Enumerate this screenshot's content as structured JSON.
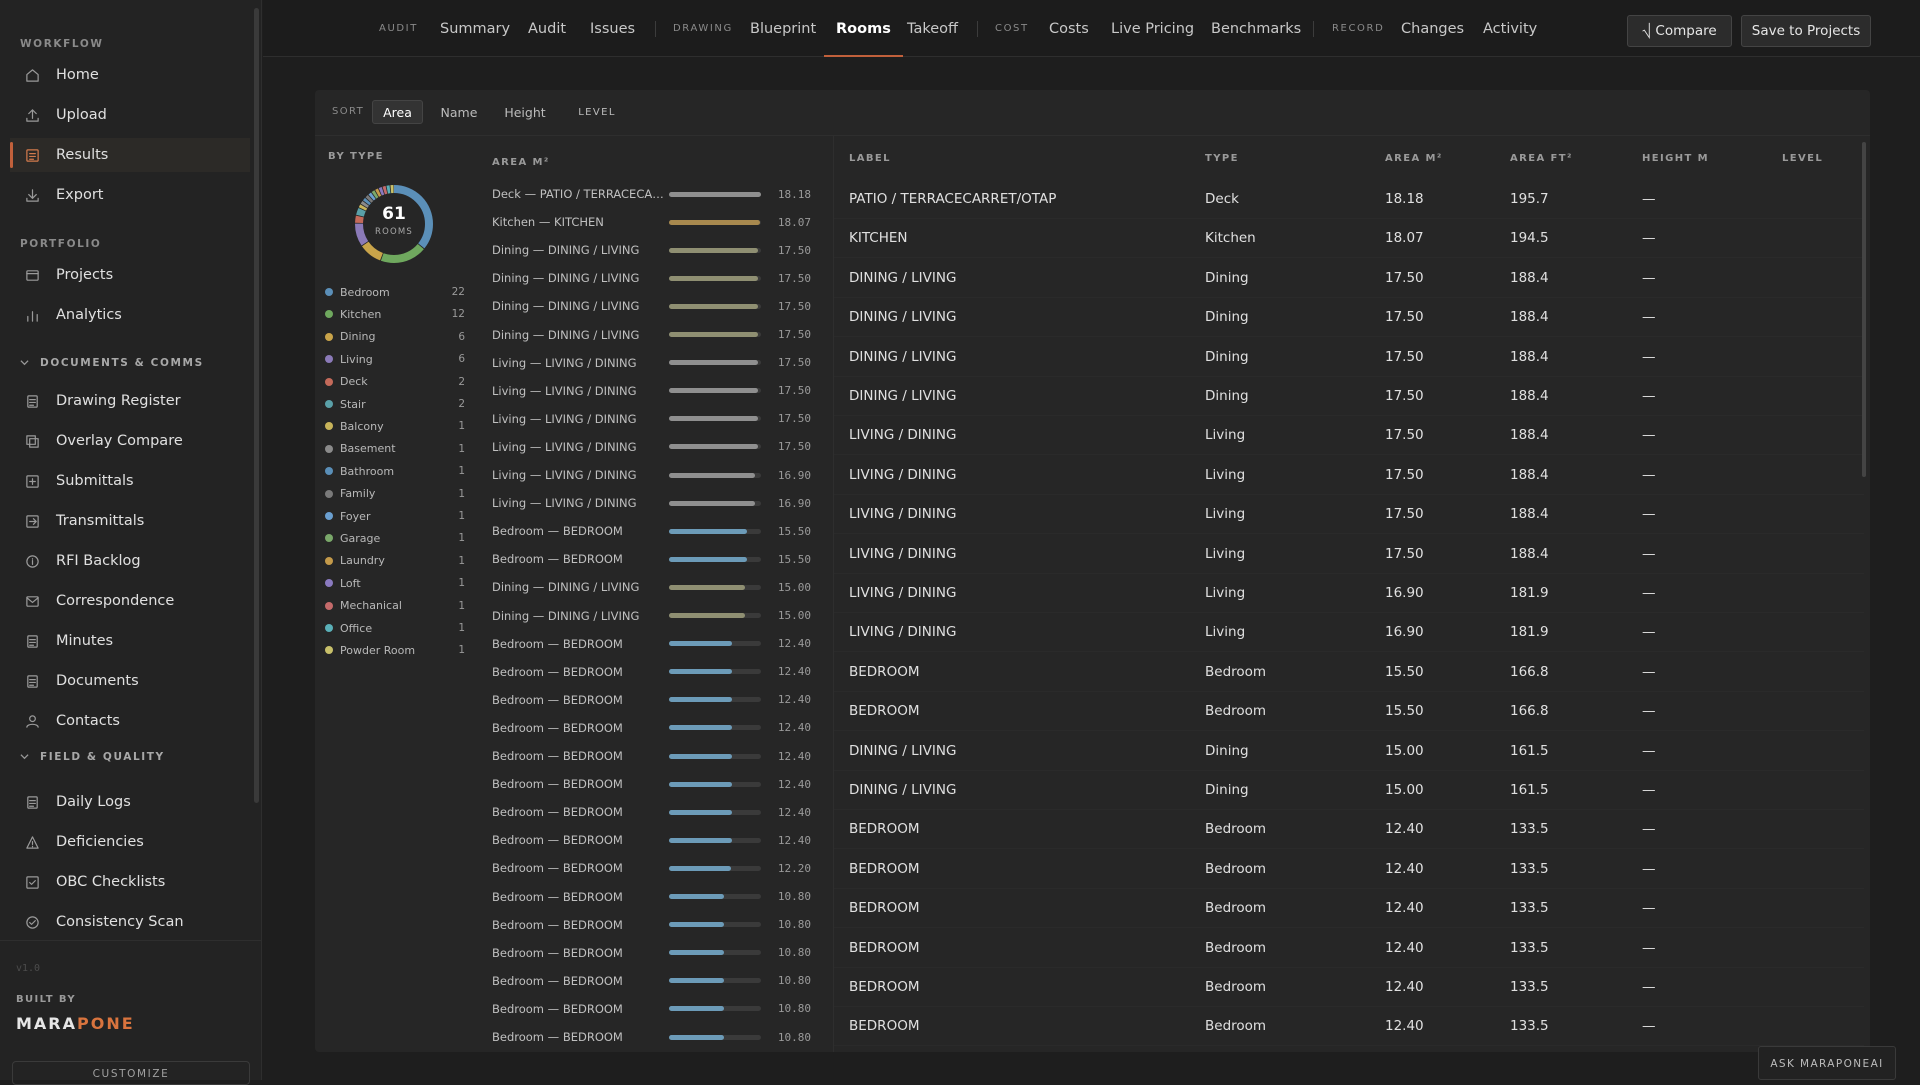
{
  "sidebar": {
    "groups": {
      "workflow": "WORKFLOW",
      "portfolio": "PORTFOLIO",
      "docs": "DOCUMENTS & COMMS",
      "field": "FIELD & QUALITY"
    },
    "items": [
      {
        "label": "Home",
        "icon": "home-icon"
      },
      {
        "label": "Upload",
        "icon": "upload-icon"
      },
      {
        "label": "Results",
        "icon": "results-icon"
      },
      {
        "label": "Export",
        "icon": "export-icon"
      },
      {
        "label": "Projects",
        "icon": "projects-icon"
      },
      {
        "label": "Analytics",
        "icon": "analytics-icon"
      },
      {
        "label": "Drawing Register",
        "icon": "document-icon"
      },
      {
        "label": "Overlay Compare",
        "icon": "overlay-icon"
      },
      {
        "label": "Submittals",
        "icon": "submittals-icon"
      },
      {
        "label": "Transmittals",
        "icon": "transmittals-icon"
      },
      {
        "label": "RFI Backlog",
        "icon": "info-icon"
      },
      {
        "label": "Correspondence",
        "icon": "mail-icon"
      },
      {
        "label": "Minutes",
        "icon": "document-icon"
      },
      {
        "label": "Documents",
        "icon": "document-icon"
      },
      {
        "label": "Contacts",
        "icon": "user-icon"
      },
      {
        "label": "Daily Logs",
        "icon": "document-icon"
      },
      {
        "label": "Deficiencies",
        "icon": "warning-icon"
      },
      {
        "label": "OBC Checklists",
        "icon": "checklist-icon"
      },
      {
        "label": "Consistency Scan",
        "icon": "check-circle-icon"
      }
    ],
    "version": "v1.0",
    "built_by": "BUILT BY",
    "brand_a": "MARA",
    "brand_b": "PONE",
    "customize": "CUSTOMIZE"
  },
  "topbar": {
    "groups": {
      "audit": "AUDIT",
      "drawing": "DRAWING",
      "cost": "COST",
      "record": "RECORD"
    },
    "tabs": {
      "summary": "Summary",
      "audit": "Audit",
      "issues": "Issues",
      "blueprint": "Blueprint",
      "rooms": "Rooms",
      "takeoff": "Takeoff",
      "costs": "Costs",
      "live_pricing": "Live Pricing",
      "benchmarks": "Benchmarks",
      "changes": "Changes",
      "activity": "Activity"
    },
    "active_tab": "Rooms",
    "compare": "⎷ Compare",
    "save": "Save to Projects"
  },
  "sort": {
    "label": "SORT",
    "options": {
      "area": "Area",
      "name": "Name",
      "height": "Height",
      "level": "LEVEL"
    },
    "active": "Area"
  },
  "by_type": {
    "title": "BY TYPE",
    "total": "61",
    "total_label": "ROOMS",
    "types": [
      {
        "name": "Bedroom",
        "count": 22,
        "color": "#5b8fb8"
      },
      {
        "name": "Kitchen",
        "count": 12,
        "color": "#6fa85e"
      },
      {
        "name": "Dining",
        "count": 6,
        "color": "#c9a44a"
      },
      {
        "name": "Living",
        "count": 6,
        "color": "#8b7ab8"
      },
      {
        "name": "Deck",
        "count": 2,
        "color": "#c46a5a"
      },
      {
        "name": "Stair",
        "count": 2,
        "color": "#5aa0a8"
      },
      {
        "name": "Balcony",
        "count": 1,
        "color": "#c8b45a"
      },
      {
        "name": "Basement",
        "count": 1,
        "color": "#8a8a8a"
      },
      {
        "name": "Bathroom",
        "count": 1,
        "color": "#5a8fb8"
      },
      {
        "name": "Family",
        "count": 1,
        "color": "#7a7a7a"
      },
      {
        "name": "Foyer",
        "count": 1,
        "color": "#6a9fd0"
      },
      {
        "name": "Garage",
        "count": 1,
        "color": "#7aa86a"
      },
      {
        "name": "Laundry",
        "count": 1,
        "color": "#c49a4a"
      },
      {
        "name": "Loft",
        "count": 1,
        "color": "#8a7ac0"
      },
      {
        "name": "Mechanical",
        "count": 1,
        "color": "#c46a6a"
      },
      {
        "name": "Office",
        "count": 1,
        "color": "#5ab0b8"
      },
      {
        "name": "Powder Room",
        "count": 1,
        "color": "#c8c06a"
      }
    ]
  },
  "area_list": {
    "title": "AREA M²",
    "rows": [
      {
        "name": "Deck — PATIO / TERRACECAR...",
        "value": "18.18",
        "color": "#8f8f8f"
      },
      {
        "name": "Kitchen — KITCHEN",
        "value": "18.07",
        "color": "#a8894e"
      },
      {
        "name": "Dining — DINING / LIVING",
        "value": "17.50",
        "color": "#8f8f72"
      },
      {
        "name": "Dining — DINING / LIVING",
        "value": "17.50",
        "color": "#8f8f72"
      },
      {
        "name": "Dining — DINING / LIVING",
        "value": "17.50",
        "color": "#8f8f72"
      },
      {
        "name": "Dining — DINING / LIVING",
        "value": "17.50",
        "color": "#8f8f72"
      },
      {
        "name": "Living — LIVING / DINING",
        "value": "17.50",
        "color": "#8f8f8f"
      },
      {
        "name": "Living — LIVING / DINING",
        "value": "17.50",
        "color": "#8f8f8f"
      },
      {
        "name": "Living — LIVING / DINING",
        "value": "17.50",
        "color": "#8f8f8f"
      },
      {
        "name": "Living — LIVING / DINING",
        "value": "17.50",
        "color": "#8f8f8f"
      },
      {
        "name": "Living — LIVING / DINING",
        "value": "16.90",
        "color": "#8f8f8f"
      },
      {
        "name": "Living — LIVING / DINING",
        "value": "16.90",
        "color": "#8f8f8f"
      },
      {
        "name": "Bedroom — BEDROOM",
        "value": "15.50",
        "color": "#6c9bb8"
      },
      {
        "name": "Bedroom — BEDROOM",
        "value": "15.50",
        "color": "#6c9bb8"
      },
      {
        "name": "Dining — DINING / LIVING",
        "value": "15.00",
        "color": "#8f8f72"
      },
      {
        "name": "Dining — DINING / LIVING",
        "value": "15.00",
        "color": "#8f8f72"
      },
      {
        "name": "Bedroom — BEDROOM",
        "value": "12.40",
        "color": "#6c9bb8"
      },
      {
        "name": "Bedroom — BEDROOM",
        "value": "12.40",
        "color": "#6c9bb8"
      },
      {
        "name": "Bedroom — BEDROOM",
        "value": "12.40",
        "color": "#6c9bb8"
      },
      {
        "name": "Bedroom — BEDROOM",
        "value": "12.40",
        "color": "#6c9bb8"
      },
      {
        "name": "Bedroom — BEDROOM",
        "value": "12.40",
        "color": "#6c9bb8"
      },
      {
        "name": "Bedroom — BEDROOM",
        "value": "12.40",
        "color": "#6c9bb8"
      },
      {
        "name": "Bedroom — BEDROOM",
        "value": "12.40",
        "color": "#6c9bb8"
      },
      {
        "name": "Bedroom — BEDROOM",
        "value": "12.40",
        "color": "#6c9bb8"
      },
      {
        "name": "Bedroom — BEDROOM",
        "value": "12.20",
        "color": "#6c9bb8"
      },
      {
        "name": "Bedroom — BEDROOM",
        "value": "10.80",
        "color": "#6c9bb8"
      },
      {
        "name": "Bedroom — BEDROOM",
        "value": "10.80",
        "color": "#6c9bb8"
      },
      {
        "name": "Bedroom — BEDROOM",
        "value": "10.80",
        "color": "#6c9bb8"
      },
      {
        "name": "Bedroom — BEDROOM",
        "value": "10.80",
        "color": "#6c9bb8"
      },
      {
        "name": "Bedroom — BEDROOM",
        "value": "10.80",
        "color": "#6c9bb8"
      },
      {
        "name": "Bedroom — BEDROOM",
        "value": "10.80",
        "color": "#6c9bb8"
      }
    ]
  },
  "table": {
    "headers": {
      "label": "LABEL",
      "type": "TYPE",
      "area_m2": "AREA M²",
      "area_ft2": "AREA FT²",
      "height": "HEIGHT M",
      "level": "LEVEL"
    },
    "rows": [
      {
        "label": "PATIO / TERRACECARRET/OTAP",
        "type": "Deck",
        "m2": "18.18",
        "ft2": "195.7",
        "h": "—"
      },
      {
        "label": "KITCHEN",
        "type": "Kitchen",
        "m2": "18.07",
        "ft2": "194.5",
        "h": "—"
      },
      {
        "label": "DINING / LIVING",
        "type": "Dining",
        "m2": "17.50",
        "ft2": "188.4",
        "h": "—"
      },
      {
        "label": "DINING / LIVING",
        "type": "Dining",
        "m2": "17.50",
        "ft2": "188.4",
        "h": "—"
      },
      {
        "label": "DINING / LIVING",
        "type": "Dining",
        "m2": "17.50",
        "ft2": "188.4",
        "h": "—"
      },
      {
        "label": "DINING / LIVING",
        "type": "Dining",
        "m2": "17.50",
        "ft2": "188.4",
        "h": "—"
      },
      {
        "label": "LIVING / DINING",
        "type": "Living",
        "m2": "17.50",
        "ft2": "188.4",
        "h": "—"
      },
      {
        "label": "LIVING / DINING",
        "type": "Living",
        "m2": "17.50",
        "ft2": "188.4",
        "h": "—"
      },
      {
        "label": "LIVING / DINING",
        "type": "Living",
        "m2": "17.50",
        "ft2": "188.4",
        "h": "—"
      },
      {
        "label": "LIVING / DINING",
        "type": "Living",
        "m2": "17.50",
        "ft2": "188.4",
        "h": "—"
      },
      {
        "label": "LIVING / DINING",
        "type": "Living",
        "m2": "16.90",
        "ft2": "181.9",
        "h": "—"
      },
      {
        "label": "LIVING / DINING",
        "type": "Living",
        "m2": "16.90",
        "ft2": "181.9",
        "h": "—"
      },
      {
        "label": "BEDROOM",
        "type": "Bedroom",
        "m2": "15.50",
        "ft2": "166.8",
        "h": "—"
      },
      {
        "label": "BEDROOM",
        "type": "Bedroom",
        "m2": "15.50",
        "ft2": "166.8",
        "h": "—"
      },
      {
        "label": "DINING / LIVING",
        "type": "Dining",
        "m2": "15.00",
        "ft2": "161.5",
        "h": "—"
      },
      {
        "label": "DINING / LIVING",
        "type": "Dining",
        "m2": "15.00",
        "ft2": "161.5",
        "h": "—"
      },
      {
        "label": "BEDROOM",
        "type": "Bedroom",
        "m2": "12.40",
        "ft2": "133.5",
        "h": "—"
      },
      {
        "label": "BEDROOM",
        "type": "Bedroom",
        "m2": "12.40",
        "ft2": "133.5",
        "h": "—"
      },
      {
        "label": "BEDROOM",
        "type": "Bedroom",
        "m2": "12.40",
        "ft2": "133.5",
        "h": "—"
      },
      {
        "label": "BEDROOM",
        "type": "Bedroom",
        "m2": "12.40",
        "ft2": "133.5",
        "h": "—"
      },
      {
        "label": "BEDROOM",
        "type": "Bedroom",
        "m2": "12.40",
        "ft2": "133.5",
        "h": "—"
      },
      {
        "label": "BEDROOM",
        "type": "Bedroom",
        "m2": "12.40",
        "ft2": "133.5",
        "h": "—"
      }
    ]
  },
  "ask": "ASK MARAPONEAI"
}
